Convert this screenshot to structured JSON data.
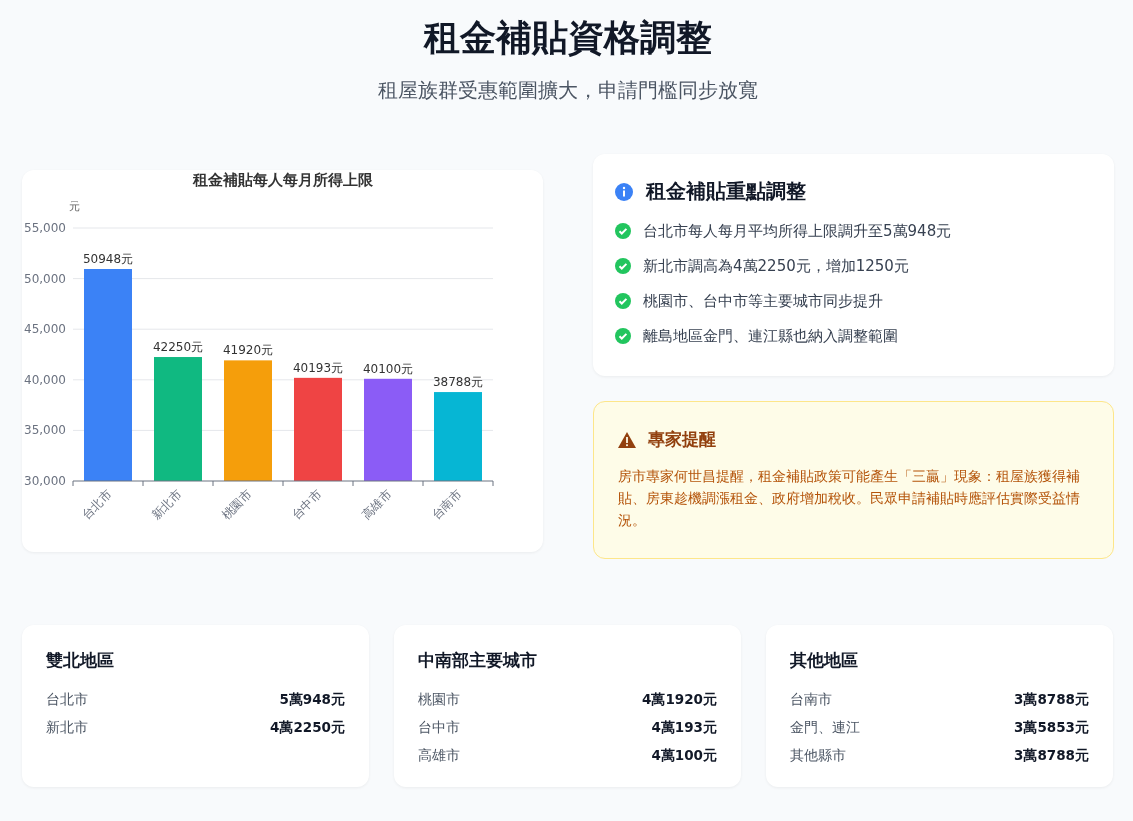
{
  "header": {
    "title": "租金補貼資格調整",
    "subtitle": "租屋族群受惠範圍擴大，申請門檻同步放寬"
  },
  "chart_card": {
    "chart_data": {
      "type": "bar",
      "title": "租金補貼每人每月所得上限",
      "ylabel": "元",
      "categories": [
        "台北市",
        "新北市",
        "桃園市",
        "台中市",
        "高雄市",
        "台南市"
      ],
      "grid": true,
      "series": [
        {
          "values": [
            50948,
            42250,
            41920,
            40193,
            40100,
            38788
          ]
        }
      ],
      "colors": [
        "#3b82f6",
        "#10b981",
        "#f59e0b",
        "#ef4444",
        "#8b5cf6",
        "#06b6d4"
      ],
      "ylim": [
        30000,
        55000
      ],
      "yticks": [
        {
          "value": 30000,
          "label": "30,000"
        },
        {
          "value": 35000,
          "label": "35,000"
        },
        {
          "value": 40000,
          "label": "40,000"
        },
        {
          "value": 45000,
          "label": "45,000"
        },
        {
          "value": 50000,
          "label": "50,000"
        },
        {
          "value": 55000,
          "label": "55,000"
        }
      ],
      "value_labels": [
        "50948元",
        "42250元",
        "41920元",
        "40193元",
        "40100元",
        "38788元"
      ]
    }
  },
  "key_points": {
    "title": "租金補貼重點調整",
    "items": [
      "台北市每人每月平均所得上限調升至5萬948元",
      "新北市調高為4萬2250元，增加1250元",
      "桃園市、台中市等主要城市同步提升",
      "離島地區金門、連江縣也納入調整範圍"
    ]
  },
  "expert_note": {
    "title": "專家提醒",
    "text": "房市專家何世昌提醒，租金補貼政策可能產生「三贏」現象：租屋族獲得補貼、房東趁機調漲租金、政府增加稅收。民眾申請補貼時應評估實際受益情況。"
  },
  "regions": [
    {
      "title": "雙北地區",
      "rows": [
        {
          "city": "台北市",
          "amount": "5萬948元"
        },
        {
          "city": "新北市",
          "amount": "4萬2250元"
        }
      ]
    },
    {
      "title": "中南部主要城市",
      "rows": [
        {
          "city": "桃園市",
          "amount": "4萬1920元"
        },
        {
          "city": "台中市",
          "amount": "4萬193元"
        },
        {
          "city": "高雄市",
          "amount": "4萬100元"
        }
      ]
    },
    {
      "title": "其他地區",
      "rows": [
        {
          "city": "台南市",
          "amount": "3萬8788元"
        },
        {
          "city": "金門、連江",
          "amount": "3萬5853元"
        },
        {
          "city": "其他縣市",
          "amount": "3萬8788元"
        }
      ]
    }
  ]
}
